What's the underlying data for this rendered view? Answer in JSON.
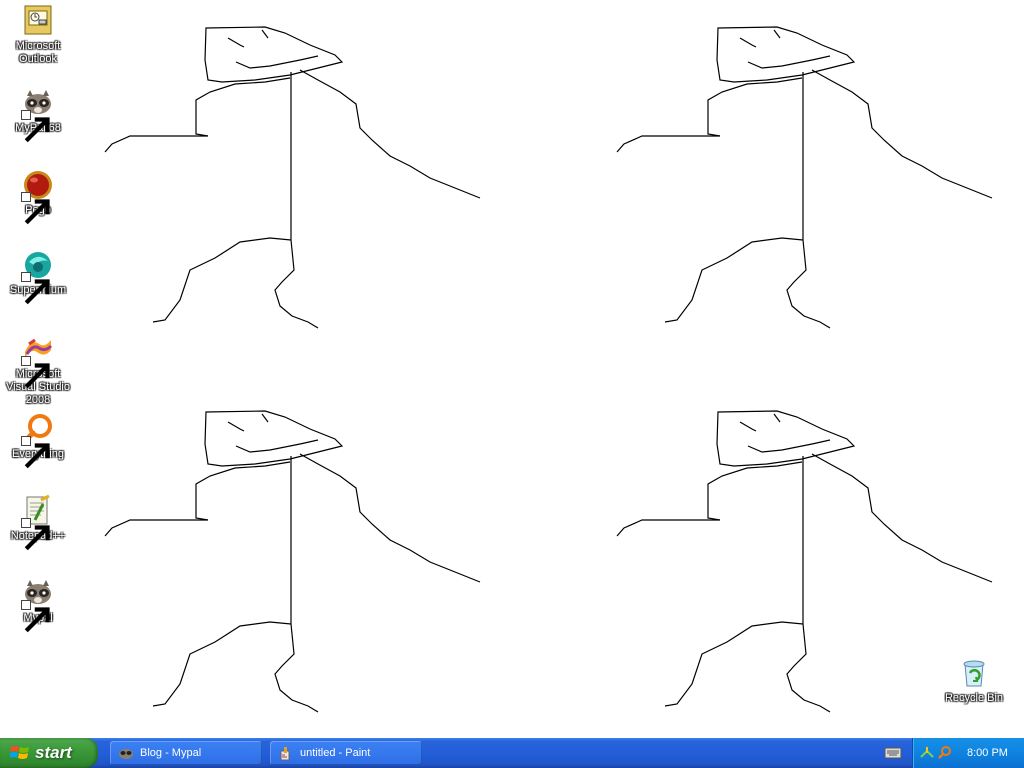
{
  "desktop": {
    "icons": [
      {
        "label": "Microsoft Outlook",
        "icon": "outlook-icon"
      },
      {
        "label": "MyPal 68",
        "icon": "raccoon-icon"
      },
      {
        "label": "Pego",
        "icon": "red-orb-icon"
      },
      {
        "label": "Supermium",
        "icon": "supermium-icon"
      },
      {
        "label": "Microsoft Visual Studio 2008",
        "icon": "visual-studio-icon"
      },
      {
        "label": "Everything",
        "icon": "magnifier-icon"
      },
      {
        "label": "Notepad++",
        "icon": "notepad-plus-icon"
      },
      {
        "label": "Mypal",
        "icon": "raccoon-icon"
      },
      {
        "label": "Recycle Bin",
        "icon": "recycle-bin-icon"
      }
    ],
    "wallpaper": "four line-art sketches on white background"
  },
  "taskbar": {
    "start_label": "start",
    "tasks": [
      {
        "label": "Blog - Mypal",
        "icon": "raccoon-icon"
      },
      {
        "label": "untitled - Paint",
        "icon": "paint-icon"
      }
    ],
    "tray_time": "8:00 PM",
    "colors": {
      "taskbar": "#245edb",
      "start": "#3c9a3a",
      "tray": "#0f83e0"
    }
  }
}
